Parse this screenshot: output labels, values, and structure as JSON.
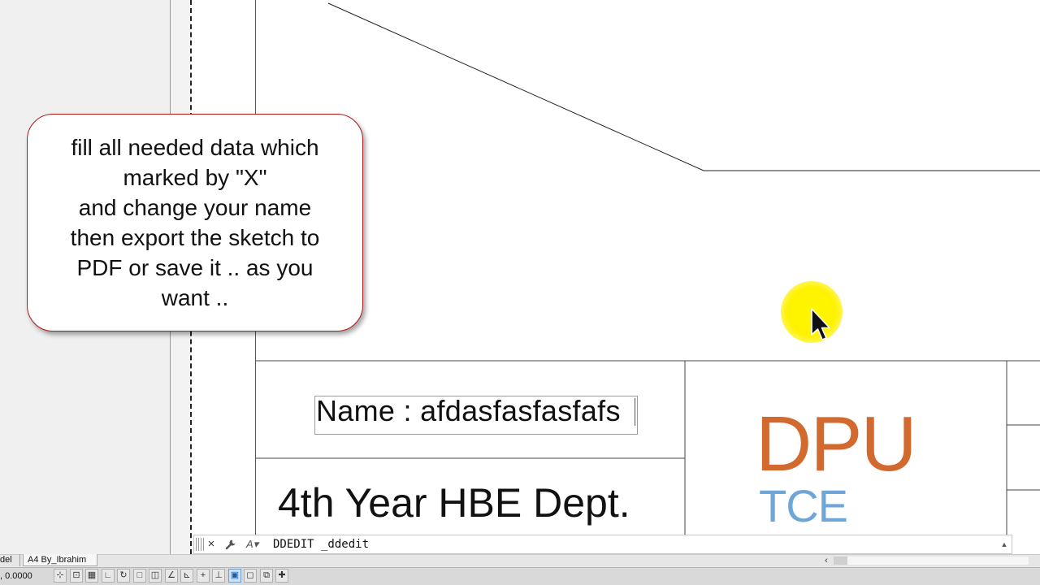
{
  "callout": {
    "text": "fill all needed data which\nmarked by \"X\"\nand change your name\nthen export the sketch to\nPDF or save it .. as you\nwant .."
  },
  "title_block": {
    "name_field": "Name : afdasfasfasfafs",
    "department": "4th Year HBE Dept.",
    "logo_main": "DPU",
    "logo_sub": "TCE",
    "logo_main_color": "#d2692e",
    "logo_sub_color": "#6ea7d7"
  },
  "command_line": {
    "close_icon": "×",
    "settings_icon": "wrench-icon",
    "recent_icon": "A▾",
    "text": "DDEDIT _ddedit"
  },
  "tabs": {
    "model": "del",
    "layout": "A4 By_Ibrahim"
  },
  "status_bar": {
    "coordinates": ", 0.0000",
    "buttons": [
      {
        "name": "infer-constraints-icon",
        "glyph": "⊹",
        "on": false
      },
      {
        "name": "snap-mode-icon",
        "glyph": "⊡",
        "on": false
      },
      {
        "name": "grid-display-icon",
        "glyph": "▦",
        "on": false
      },
      {
        "name": "ortho-mode-icon",
        "glyph": "∟",
        "on": false
      },
      {
        "name": "polar-tracking-icon",
        "glyph": "↻",
        "on": false
      },
      {
        "name": "object-snap-icon",
        "glyph": "□",
        "on": false
      },
      {
        "name": "3d-object-snap-icon",
        "glyph": "◫",
        "on": false
      },
      {
        "name": "object-snap-tracking-icon",
        "glyph": "∠",
        "on": false
      },
      {
        "name": "dynamic-ucs-icon",
        "glyph": "⊾",
        "on": false
      },
      {
        "name": "dynamic-input-icon",
        "glyph": "+",
        "on": false
      },
      {
        "name": "lineweight-icon",
        "glyph": "⊥",
        "on": false
      },
      {
        "name": "transparency-icon",
        "glyph": "▣",
        "on": true
      },
      {
        "name": "quick-properties-icon",
        "glyph": "◻",
        "on": false
      },
      {
        "name": "selection-cycling-icon",
        "glyph": "⧉",
        "on": false
      },
      {
        "name": "annotation-monitor-icon",
        "glyph": "✚",
        "on": false
      }
    ]
  },
  "colors": {
    "callout_border": "#b01a1a",
    "pointer_highlight": "#fff200"
  }
}
